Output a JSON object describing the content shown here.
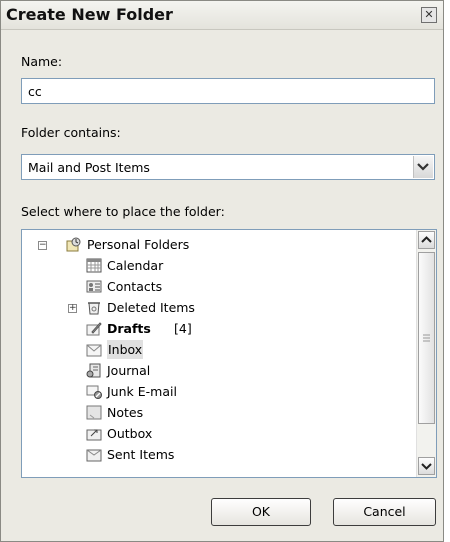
{
  "dialog": {
    "title": "Create New Folder",
    "close_label": "✕"
  },
  "name_field": {
    "label": "Name:",
    "value": "cc"
  },
  "contains": {
    "label": "Folder contains:",
    "value": "Mail and Post Items"
  },
  "place": {
    "label": "Select where to place the folder:"
  },
  "tree": {
    "root": {
      "label": "Personal Folders",
      "icon": "personal-folders-icon",
      "expander": "−"
    },
    "items": [
      {
        "label": "Calendar",
        "icon": "calendar-icon"
      },
      {
        "label": "Contacts",
        "icon": "contacts-icon"
      },
      {
        "label": "Deleted Items",
        "icon": "deleted-items-icon",
        "expander": "+"
      },
      {
        "label": "Drafts",
        "icon": "drafts-icon",
        "count": "[4]",
        "bold": true
      },
      {
        "label": "Inbox",
        "icon": "inbox-icon",
        "selected": true
      },
      {
        "label": "Journal",
        "icon": "journal-icon"
      },
      {
        "label": "Junk E-mail",
        "icon": "junk-email-icon"
      },
      {
        "label": "Notes",
        "icon": "notes-icon"
      },
      {
        "label": "Outbox",
        "icon": "outbox-icon"
      },
      {
        "label": "Sent Items",
        "icon": "sent-items-icon"
      }
    ]
  },
  "buttons": {
    "ok": "OK",
    "cancel": "Cancel"
  }
}
